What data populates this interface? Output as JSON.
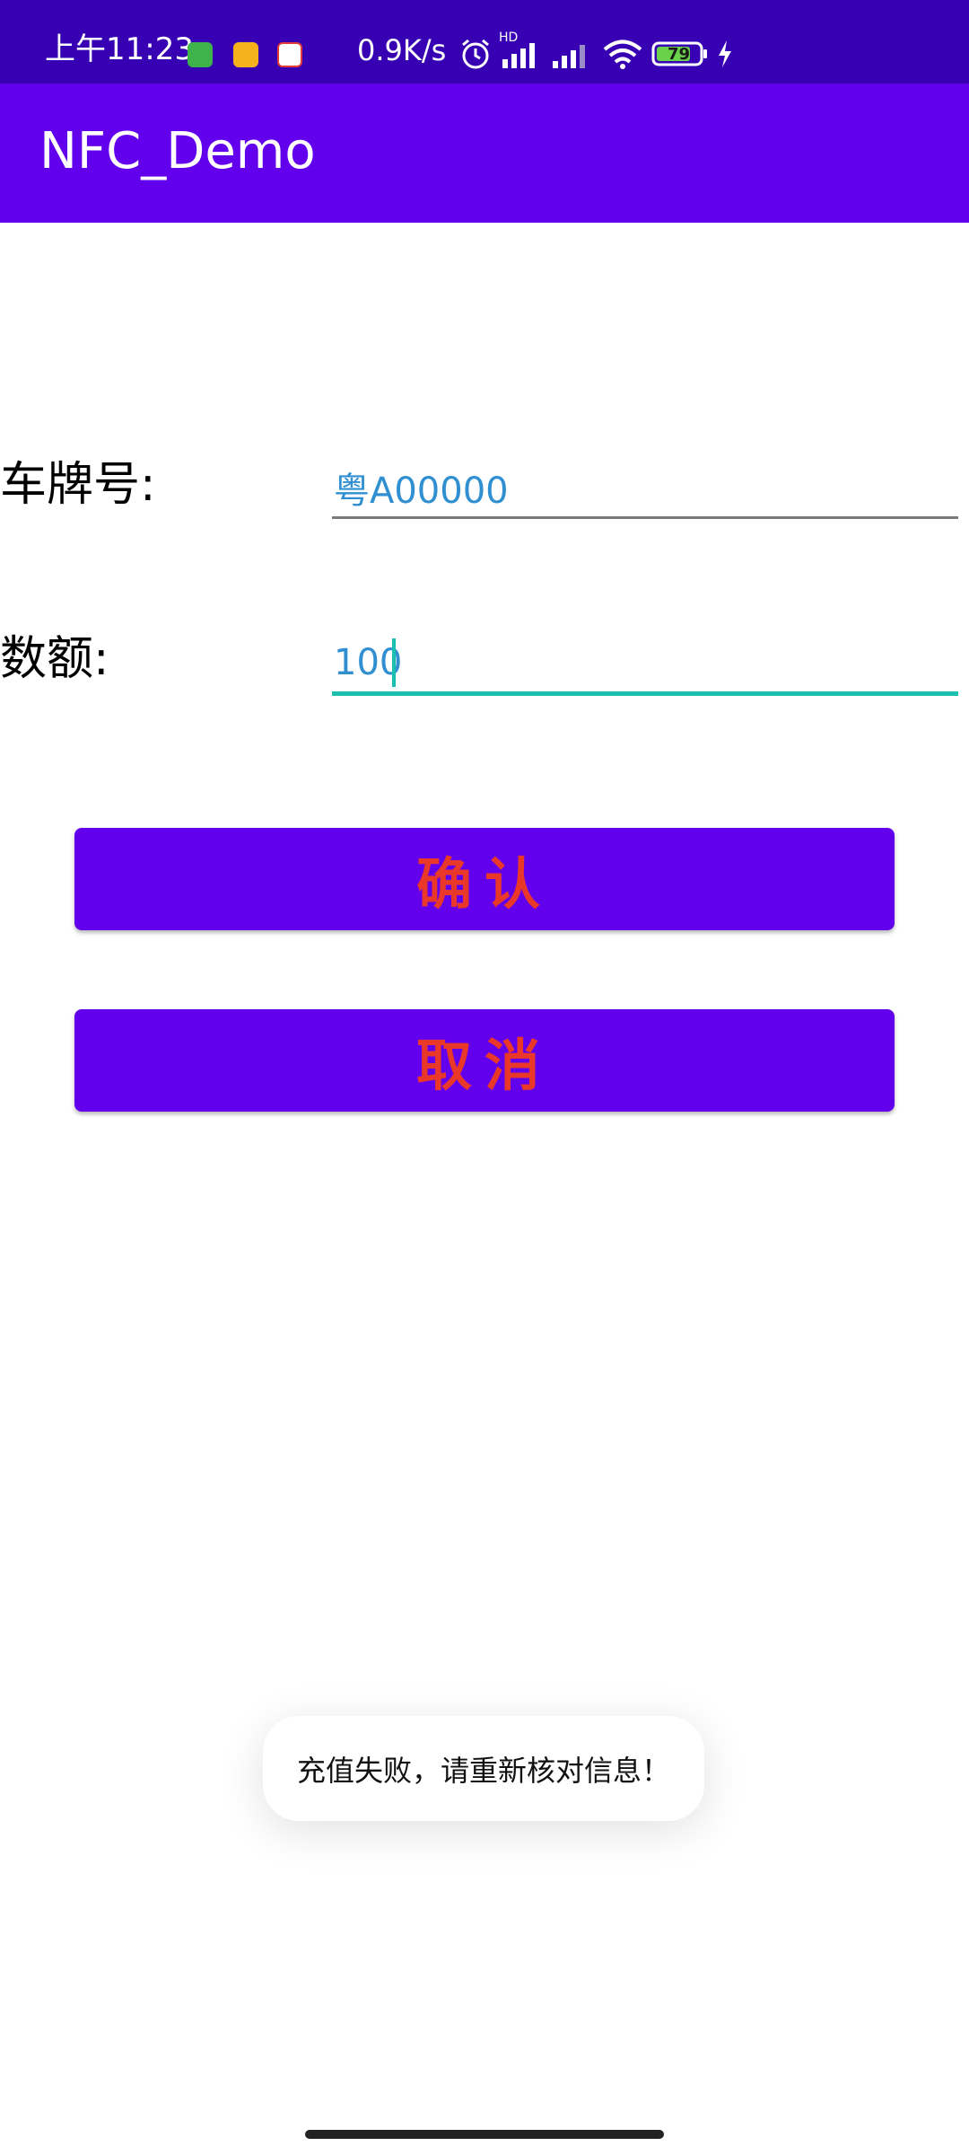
{
  "status_bar": {
    "time": "上午11:23",
    "speed": "0.9K/s",
    "network_tag": "HD",
    "battery": "79",
    "icons": [
      "app-green-icon",
      "app-yellow-icon",
      "app-news-icon",
      "alarm-icon",
      "signal-icon",
      "signal-icon-2",
      "wifi-icon",
      "battery-icon",
      "charging-icon"
    ]
  },
  "app_bar": {
    "title": "NFC_Demo"
  },
  "form": {
    "plate_label": "车牌号:",
    "plate_value": "粤A00000",
    "amount_label": "数额:",
    "amount_value": "100"
  },
  "buttons": {
    "confirm": "确认",
    "cancel": "取消"
  },
  "toast": {
    "message": "充值失败，请重新核对信息！"
  },
  "colors": {
    "primary": "#6200ee",
    "primary_dark": "#3700b3",
    "button_text": "#e9372a",
    "field_text": "#2f8fd1",
    "focus_accent": "#1bbfb0"
  }
}
